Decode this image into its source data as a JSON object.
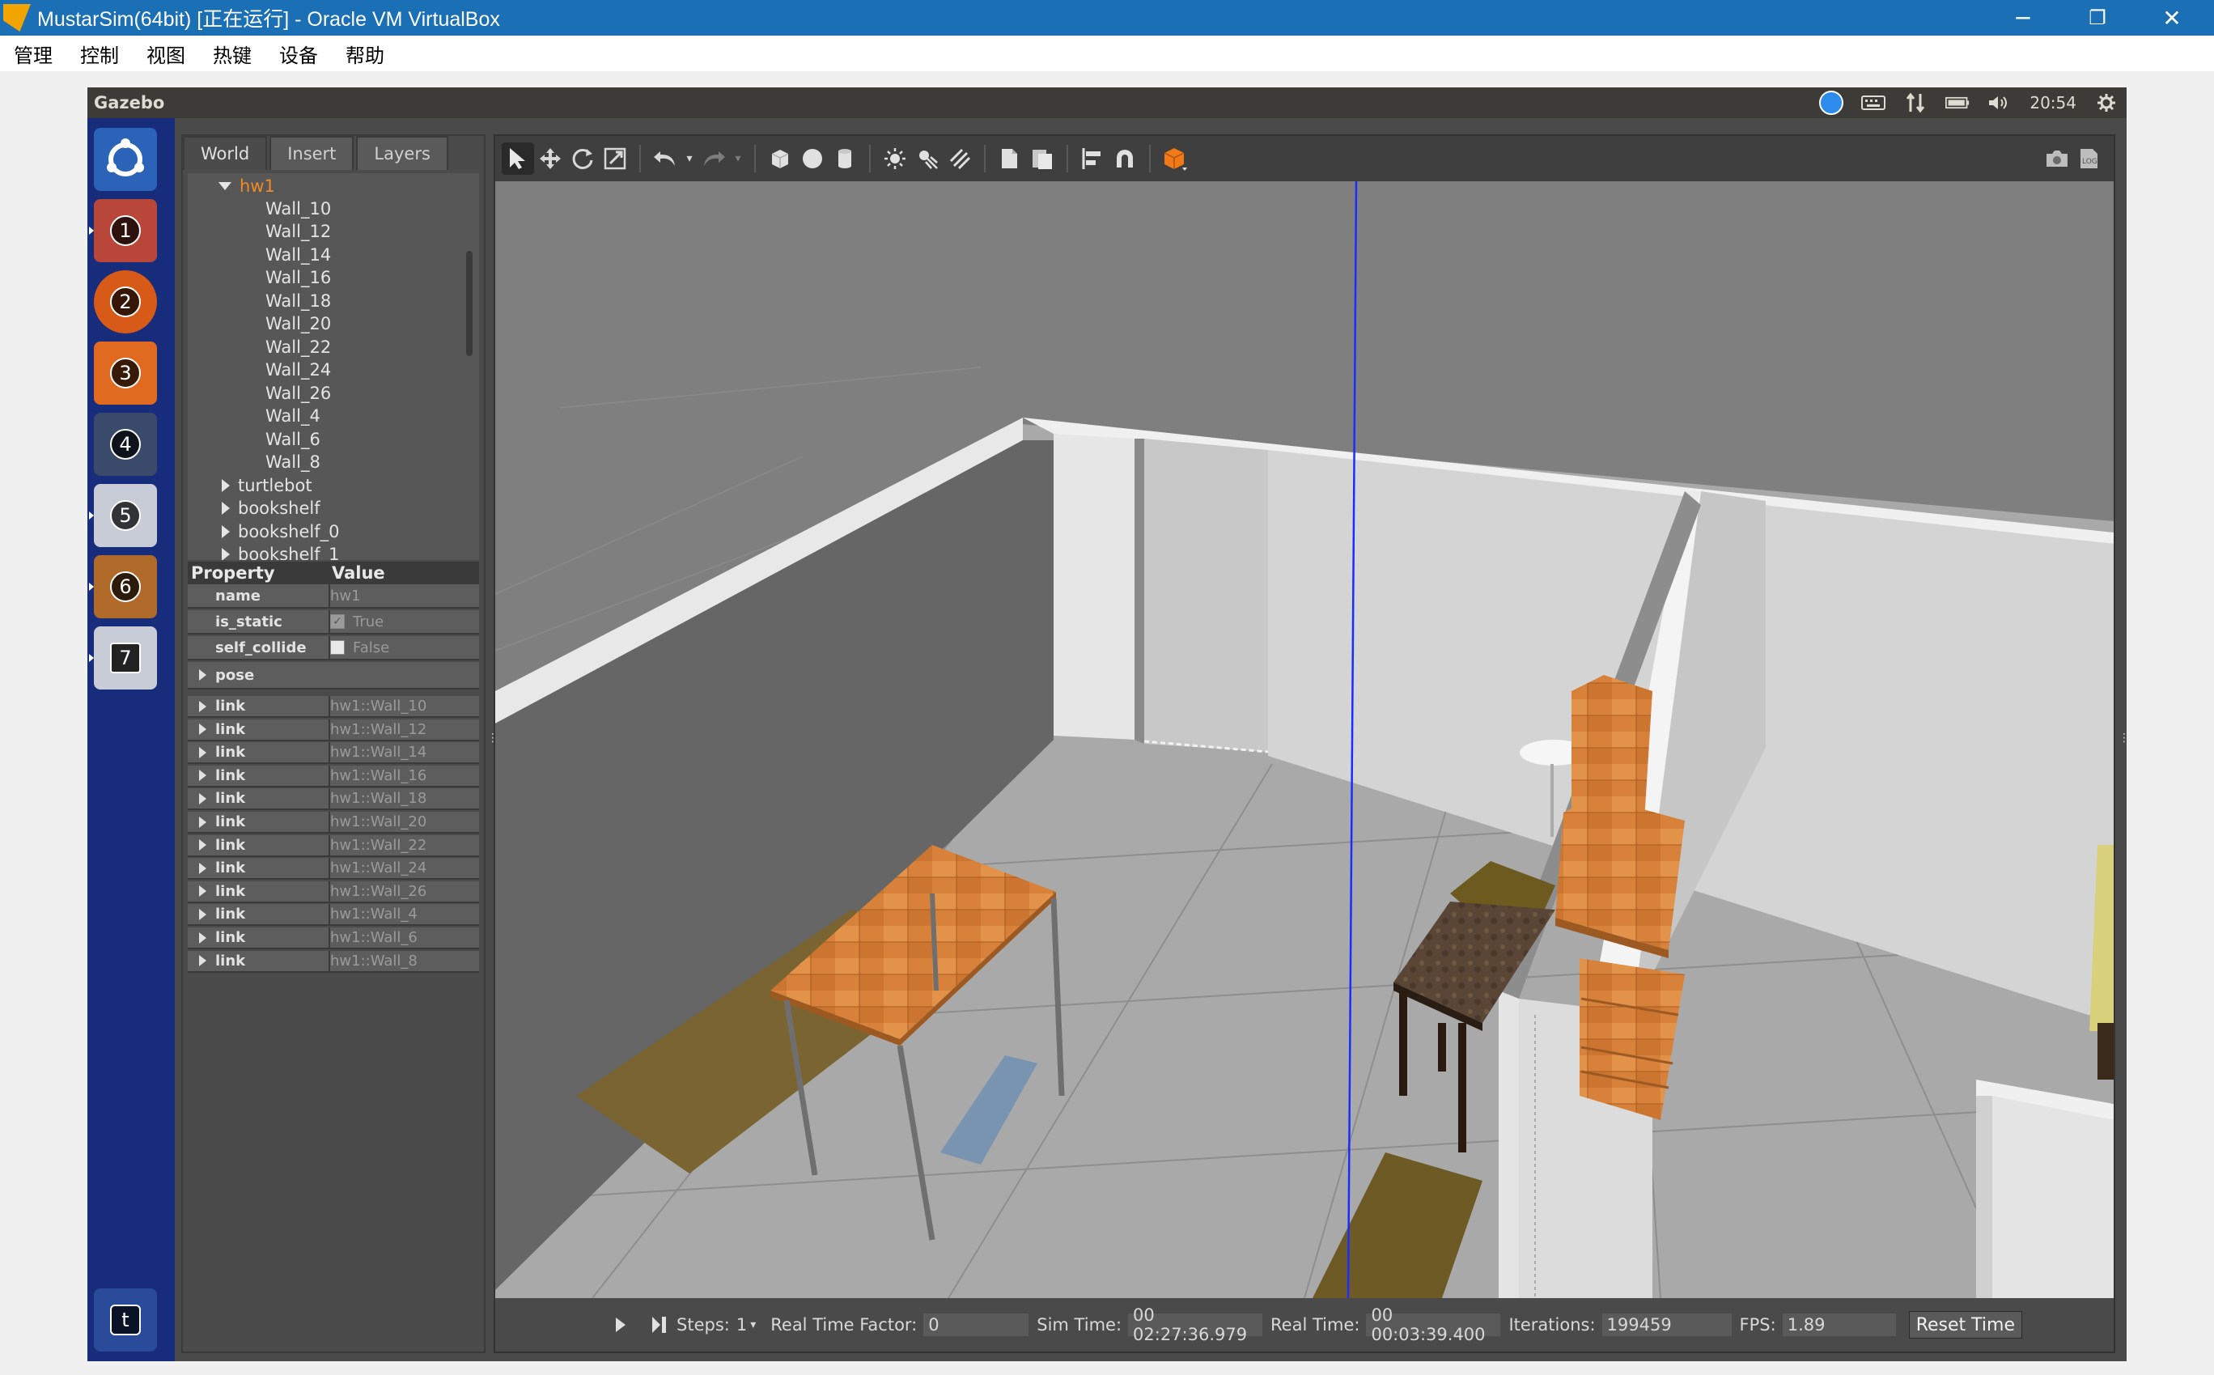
{
  "host": {
    "title": "MustarSim(64bit) [正在运行] - Oracle VM VirtualBox",
    "menu": [
      "管理",
      "控制",
      "视图",
      "热键",
      "设备",
      "帮助"
    ],
    "minimize": "─",
    "restore": "❐",
    "close": "✕"
  },
  "guest": {
    "app_name": "Gazebo",
    "clock": "20:54",
    "launcher_numbers": [
      "1",
      "2",
      "3",
      "4",
      "5",
      "6",
      "7"
    ],
    "trash_label": "t"
  },
  "left_panel": {
    "tabs": [
      "World",
      "Insert",
      "Layers"
    ],
    "tree_root": "hw1",
    "tree_children": [
      "Wall_10",
      "Wall_12",
      "Wall_14",
      "Wall_16",
      "Wall_18",
      "Wall_20",
      "Wall_22",
      "Wall_24",
      "Wall_26",
      "Wall_4",
      "Wall_6",
      "Wall_8"
    ],
    "tree_models": [
      "turtlebot",
      "bookshelf",
      "bookshelf_0",
      "bookshelf_1"
    ],
    "props_header": {
      "property": "Property",
      "value": "Value"
    },
    "props": [
      {
        "name": "name",
        "value": "hw1"
      },
      {
        "name": "is_static",
        "value": "True",
        "checked": true
      },
      {
        "name": "self_collide",
        "value": "False",
        "checked": false
      }
    ],
    "pose_label": "pose",
    "links": [
      {
        "name": "link",
        "value": "hw1::Wall_10"
      },
      {
        "name": "link",
        "value": "hw1::Wall_12"
      },
      {
        "name": "link",
        "value": "hw1::Wall_14"
      },
      {
        "name": "link",
        "value": "hw1::Wall_16"
      },
      {
        "name": "link",
        "value": "hw1::Wall_18"
      },
      {
        "name": "link",
        "value": "hw1::Wall_20"
      },
      {
        "name": "link",
        "value": "hw1::Wall_22"
      },
      {
        "name": "link",
        "value": "hw1::Wall_24"
      },
      {
        "name": "link",
        "value": "hw1::Wall_26"
      },
      {
        "name": "link",
        "value": "hw1::Wall_4"
      },
      {
        "name": "link",
        "value": "hw1::Wall_6"
      },
      {
        "name": "link",
        "value": "hw1::Wall_8"
      }
    ]
  },
  "bottombar": {
    "steps_label": "Steps:",
    "steps_value": "1",
    "rtf_label": "Real Time Factor:",
    "rtf_value": "0",
    "sim_time_label": "Sim Time:",
    "sim_time_value": "00 02:27:36.979",
    "real_time_label": "Real Time:",
    "real_time_value": "00 00:03:39.400",
    "iterations_label": "Iterations:",
    "iterations_value": "199459",
    "fps_label": "FPS:",
    "fps_value": "1.89",
    "reset_label": "Reset Time"
  },
  "colors": {
    "titlebar": "#1a6fb5",
    "launcher": "#172c7a",
    "selected_model": "#f08a24",
    "z_axis": "#1a2cff"
  }
}
